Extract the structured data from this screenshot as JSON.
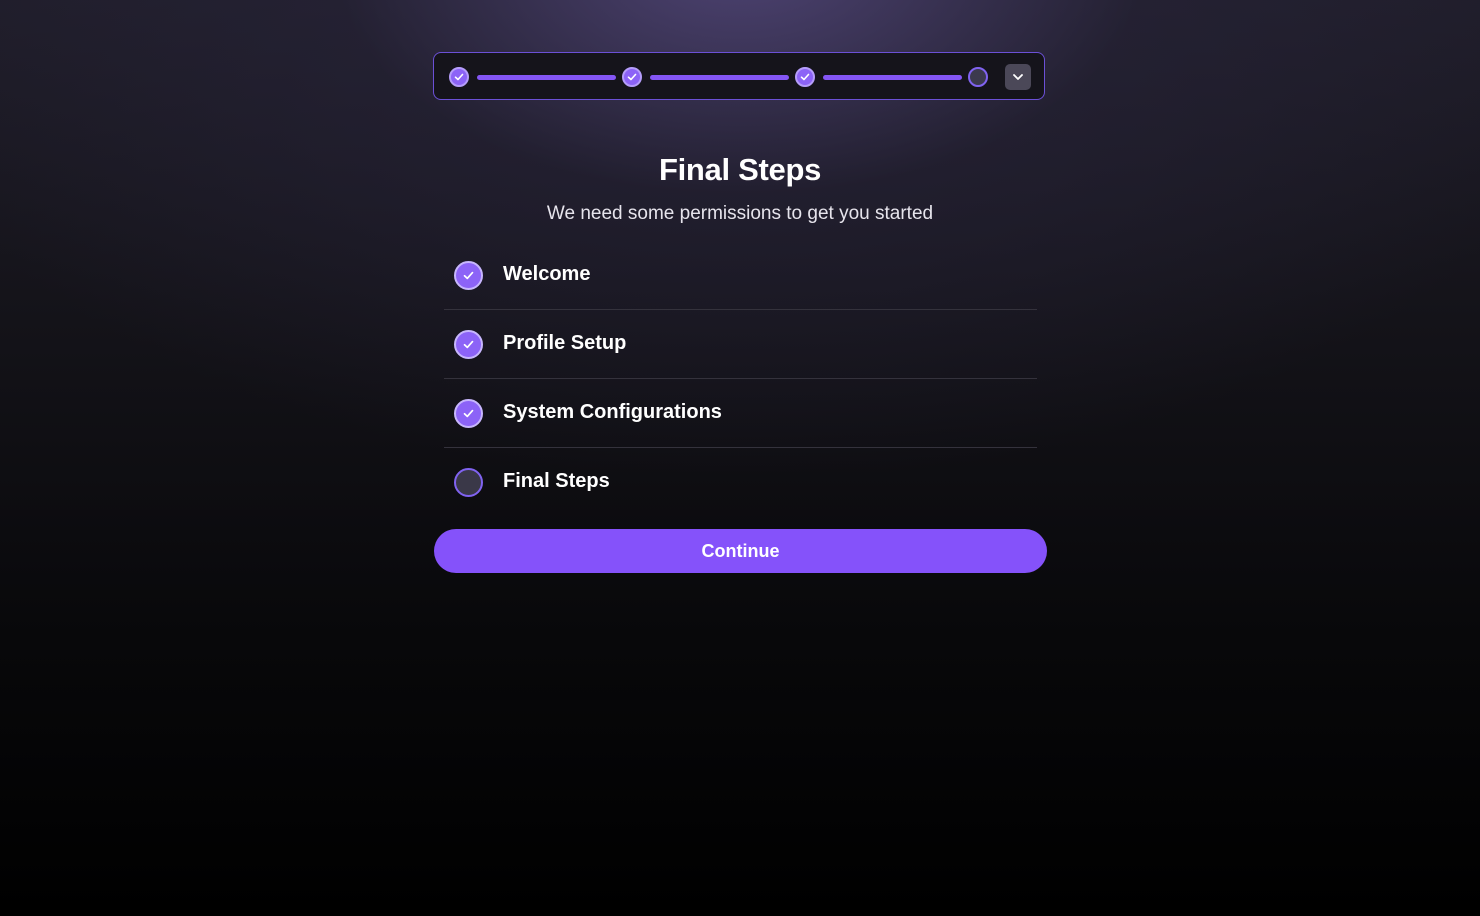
{
  "colors": {
    "accent": "#8552fa",
    "accent_light": "#b59dfb",
    "pending_fill": "#3c3a4e",
    "divider": "#34323c"
  },
  "progress": {
    "completed_steps": 3,
    "total_steps": 4,
    "toggle_icon": "chevron-down-icon",
    "done_icon": "checkmark-icon"
  },
  "header": {
    "title": "Final Steps",
    "subtitle": "We need some permissions to get you started"
  },
  "steps": [
    {
      "label": "Welcome",
      "status": "done"
    },
    {
      "label": "Profile Setup",
      "status": "done"
    },
    {
      "label": "System Configurations",
      "status": "done"
    },
    {
      "label": "Final Steps",
      "status": "pending"
    }
  ],
  "actions": {
    "continue_label": "Continue"
  }
}
